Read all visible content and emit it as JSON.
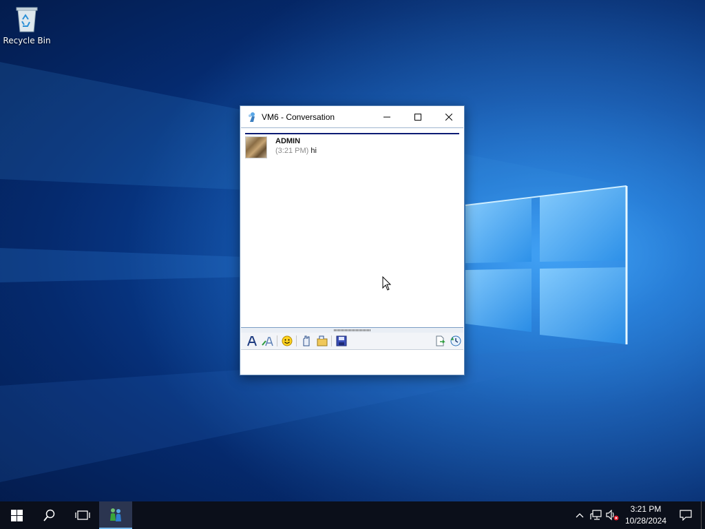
{
  "desktop": {
    "icons": [
      {
        "label": "Recycle Bin",
        "icon": "recycle-bin-icon"
      }
    ]
  },
  "window": {
    "title": "VM6 - Conversation",
    "controls": [
      "minimize",
      "maximize",
      "close"
    ],
    "messages": [
      {
        "author": "ADMIN",
        "time": "(3:21 PM)",
        "text": "hi"
      }
    ],
    "toolbar": {
      "icons": [
        "font-icon",
        "font-color-icon",
        "emoticon-icon",
        "nudge-icon",
        "send-file-icon",
        "save-icon",
        "history-icon",
        "timestamp-icon"
      ]
    },
    "input_value": ""
  },
  "taskbar": {
    "items": [
      "start-icon",
      "search-icon",
      "task-view-icon",
      "messenger-app-icon"
    ],
    "tray": {
      "time": "3:21 PM",
      "date": "10/28/2024"
    }
  },
  "colors": {
    "accent": "#0078d7",
    "header_rule": "#0b1a73",
    "timestamp": "#8a8a8a"
  }
}
